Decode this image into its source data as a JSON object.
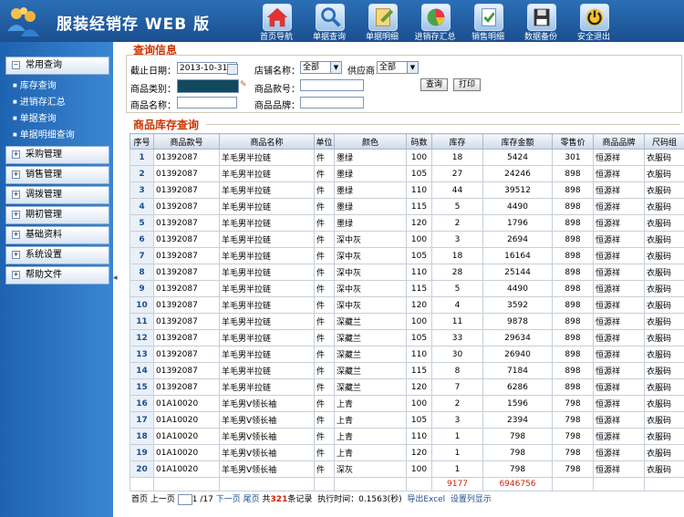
{
  "app": {
    "title": "服装经销存 WEB 版"
  },
  "nav": [
    {
      "label": "首页导航",
      "icon": "home-icon"
    },
    {
      "label": "单据查询",
      "icon": "search-icon"
    },
    {
      "label": "单据明细",
      "icon": "document-edit-icon"
    },
    {
      "label": "进销存汇总",
      "icon": "pie-chart-icon"
    },
    {
      "label": "销售明细",
      "icon": "sales-detail-icon"
    },
    {
      "label": "数据备份",
      "icon": "save-disk-icon"
    },
    {
      "label": "安全退出",
      "icon": "power-icon"
    }
  ],
  "sidebar": {
    "groups": [
      {
        "label": "常用查询",
        "expanded": true,
        "items": [
          "库存查询",
          "进销存汇总",
          "单据查询",
          "单据明细查询"
        ]
      },
      {
        "label": "采购管理"
      },
      {
        "label": "销售管理"
      },
      {
        "label": "调拨管理"
      },
      {
        "label": "期初管理"
      },
      {
        "label": "基础资料"
      },
      {
        "label": "系统设置"
      },
      {
        "label": "帮助文件"
      }
    ]
  },
  "query": {
    "section_title": "查询信息",
    "date_label": "截止日期：",
    "date_value": "2013-10-31",
    "store_label": "店铺名称：",
    "store_value": "全部",
    "supplier_label": "供应商：",
    "supplier_value": "全部",
    "category_label": "商品类别：",
    "code_label": "商品款号：",
    "name_label": "商品名称：",
    "brand_label": "商品品牌：",
    "search_button": "查询",
    "print_button": "打印"
  },
  "table": {
    "section_title": "商品库存查询",
    "headers": [
      "序号",
      "商品款号",
      "商品名称",
      "单位",
      "颜色",
      "码数",
      "库存",
      "库存金额",
      "零售价",
      "商品品牌",
      "尺码组"
    ],
    "rows": [
      [
        "1",
        "01392087",
        "羊毛男半拉链",
        "件",
        "墨绿",
        "100",
        "18",
        "5424",
        "301",
        "恒源祥",
        "衣服码"
      ],
      [
        "2",
        "01392087",
        "羊毛男半拉链",
        "件",
        "墨绿",
        "105",
        "27",
        "24246",
        "898",
        "恒源祥",
        "衣服码"
      ],
      [
        "3",
        "01392087",
        "羊毛男半拉链",
        "件",
        "墨绿",
        "110",
        "44",
        "39512",
        "898",
        "恒源祥",
        "衣服码"
      ],
      [
        "4",
        "01392087",
        "羊毛男半拉链",
        "件",
        "墨绿",
        "115",
        "5",
        "4490",
        "898",
        "恒源祥",
        "衣服码"
      ],
      [
        "5",
        "01392087",
        "羊毛男半拉链",
        "件",
        "墨绿",
        "120",
        "2",
        "1796",
        "898",
        "恒源祥",
        "衣服码"
      ],
      [
        "6",
        "01392087",
        "羊毛男半拉链",
        "件",
        "深中灰",
        "100",
        "3",
        "2694",
        "898",
        "恒源祥",
        "衣服码"
      ],
      [
        "7",
        "01392087",
        "羊毛男半拉链",
        "件",
        "深中灰",
        "105",
        "18",
        "16164",
        "898",
        "恒源祥",
        "衣服码"
      ],
      [
        "8",
        "01392087",
        "羊毛男半拉链",
        "件",
        "深中灰",
        "110",
        "28",
        "25144",
        "898",
        "恒源祥",
        "衣服码"
      ],
      [
        "9",
        "01392087",
        "羊毛男半拉链",
        "件",
        "深中灰",
        "115",
        "5",
        "4490",
        "898",
        "恒源祥",
        "衣服码"
      ],
      [
        "10",
        "01392087",
        "羊毛男半拉链",
        "件",
        "深中灰",
        "120",
        "4",
        "3592",
        "898",
        "恒源祥",
        "衣服码"
      ],
      [
        "11",
        "01392087",
        "羊毛男半拉链",
        "件",
        "深藏兰",
        "100",
        "11",
        "9878",
        "898",
        "恒源祥",
        "衣服码"
      ],
      [
        "12",
        "01392087",
        "羊毛男半拉链",
        "件",
        "深藏兰",
        "105",
        "33",
        "29634",
        "898",
        "恒源祥",
        "衣服码"
      ],
      [
        "13",
        "01392087",
        "羊毛男半拉链",
        "件",
        "深藏兰",
        "110",
        "30",
        "26940",
        "898",
        "恒源祥",
        "衣服码"
      ],
      [
        "14",
        "01392087",
        "羊毛男半拉链",
        "件",
        "深藏兰",
        "115",
        "8",
        "7184",
        "898",
        "恒源祥",
        "衣服码"
      ],
      [
        "15",
        "01392087",
        "羊毛男半拉链",
        "件",
        "深藏兰",
        "120",
        "7",
        "6286",
        "898",
        "恒源祥",
        "衣服码"
      ],
      [
        "16",
        "01A10020",
        "羊毛男V领长袖",
        "件",
        "上青",
        "100",
        "2",
        "1596",
        "798",
        "恒源祥",
        "衣服码"
      ],
      [
        "17",
        "01A10020",
        "羊毛男V领长袖",
        "件",
        "上青",
        "105",
        "3",
        "2394",
        "798",
        "恒源祥",
        "衣服码"
      ],
      [
        "18",
        "01A10020",
        "羊毛男V领长袖",
        "件",
        "上青",
        "110",
        "1",
        "798",
        "798",
        "恒源祥",
        "衣服码"
      ],
      [
        "19",
        "01A10020",
        "羊毛男V领长袖",
        "件",
        "上青",
        "120",
        "1",
        "798",
        "798",
        "恒源祥",
        "衣服码"
      ],
      [
        "20",
        "01A10020",
        "羊毛男V领长袖",
        "件",
        "深灰",
        "100",
        "1",
        "798",
        "798",
        "恒源祥",
        "衣服码"
      ]
    ],
    "totals": {
      "stock": "9177",
      "amount": "6946756"
    }
  },
  "pager": {
    "first": "首页",
    "prev": "上一页",
    "current": "1",
    "total_pages": "/17",
    "next": "下一页",
    "last": "尾页",
    "total_prefix": "共",
    "total_count": "321",
    "total_suffix": "条记录",
    "exec_time": "执行时间：0.1563(秒)",
    "export": "导出Excel",
    "columns": "设置列显示"
  },
  "colors": {
    "header": "#1b4f8f",
    "sidebar": "#2c74c2",
    "accent_red": "#cc2200",
    "link_blue": "#1a4f8c"
  }
}
